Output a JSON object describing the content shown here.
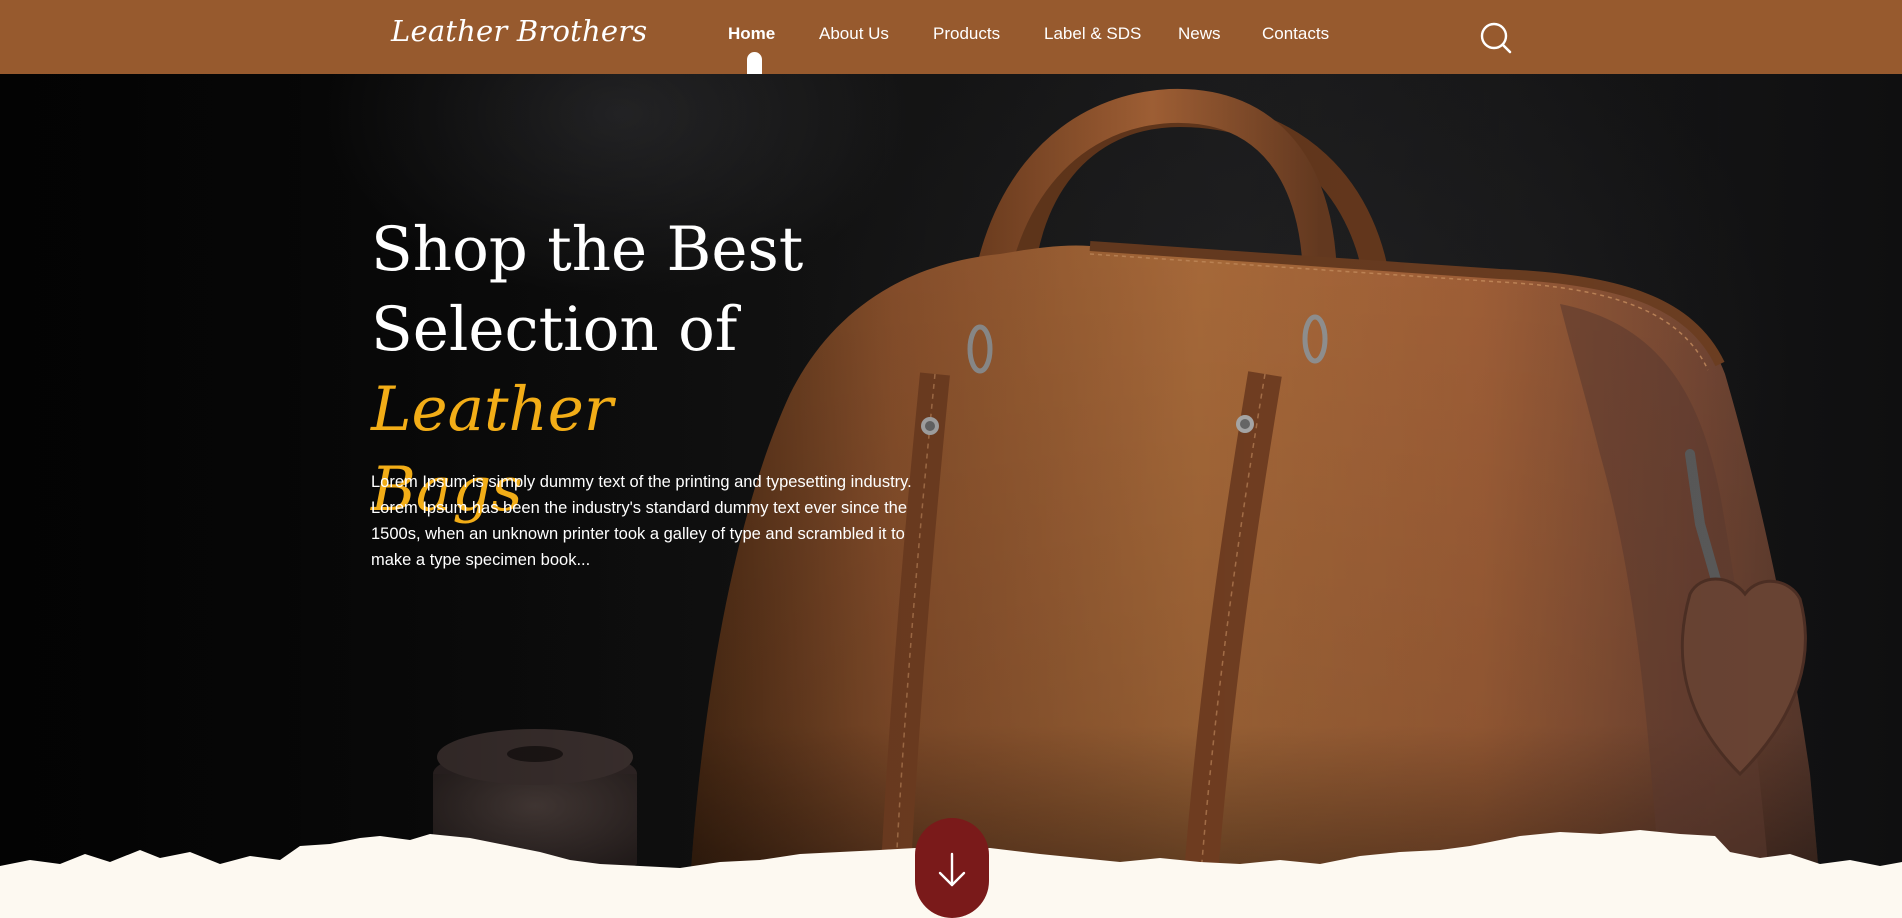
{
  "brand": {
    "name": "Leather Brothers"
  },
  "nav": {
    "items": [
      {
        "label": "Home",
        "active": true
      },
      {
        "label": "About Us"
      },
      {
        "label": "Products"
      },
      {
        "label": "Label & SDS"
      },
      {
        "label": "News"
      },
      {
        "label": "Contacts"
      }
    ],
    "search_icon": "search-icon"
  },
  "hero": {
    "title_line1": "Shop the Best",
    "title_line2_plain": "Selection of ",
    "title_line2_accent": "Leather",
    "title_line3_accent": "Bags",
    "description": "Lorem Ipsum is simply dummy text of the printing and typesetting industry. Lorem Ipsum has been the industry's standard dummy text ever since the 1500s, when an unknown printer took a galley of type and scrambled it to make a type specimen book...",
    "image_subject": "brown leather duffel bag on dark background"
  },
  "scroll_button": {
    "icon": "arrow-down-icon"
  },
  "colors": {
    "navbar": "#975a2e",
    "accent": "#f2ad17",
    "scroll_button": "#7a1a1a",
    "page_background": "#fdf9f1",
    "leather": "#a0603a"
  }
}
